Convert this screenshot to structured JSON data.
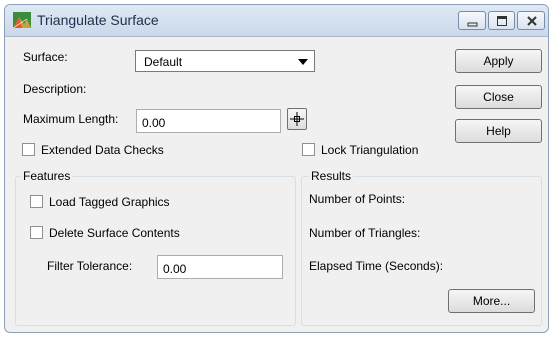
{
  "window": {
    "title": "Triangulate Surface"
  },
  "form": {
    "surface_label": "Surface:",
    "surface_value": "Default",
    "description_label": "Description:",
    "max_length_label": "Maximum Length:",
    "max_length_value": "0.00",
    "extended_checks_label": "Extended Data Checks",
    "lock_triangulation_label": "Lock Triangulation"
  },
  "buttons": {
    "apply": "Apply",
    "close": "Close",
    "help": "Help",
    "more": "More..."
  },
  "features": {
    "title": "Features",
    "load_tagged_label": "Load Tagged Graphics",
    "delete_contents_label": "Delete Surface Contents",
    "filter_tolerance_label": "Filter Tolerance:",
    "filter_tolerance_value": "0.00"
  },
  "results": {
    "title": "Results",
    "points_label": "Number of Points:",
    "triangles_label": "Number of Triangles:",
    "elapsed_label": "Elapsed Time (Seconds):"
  }
}
